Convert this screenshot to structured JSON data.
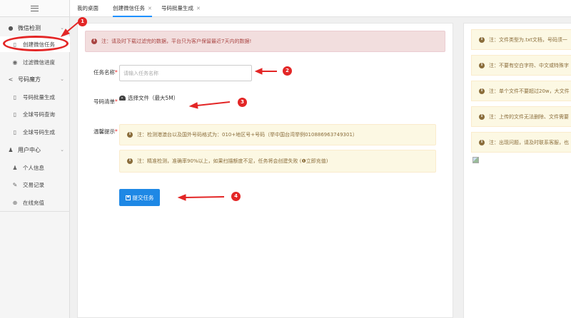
{
  "sidebar": {
    "groups": [
      {
        "label": "微信检测",
        "icon": "wechat-icon"
      },
      {
        "label": "号码魔方",
        "icon": "share-icon"
      },
      {
        "label": "用户中心",
        "icon": "users-icon"
      }
    ],
    "items": [
      {
        "label": "创建微信任务",
        "icon": "file-icon",
        "active": true
      },
      {
        "label": "过滤微信进度",
        "icon": "eye-icon"
      },
      {
        "label": "号码批量生成",
        "icon": "file-icon"
      },
      {
        "label": "全球号码查询",
        "icon": "file-icon"
      },
      {
        "label": "全球号码生成",
        "icon": "file-icon"
      },
      {
        "label": "个人信息",
        "icon": "user-icon"
      },
      {
        "label": "交易记录",
        "icon": "edit-icon"
      },
      {
        "label": "在线充值",
        "icon": "plus-circle-icon"
      }
    ]
  },
  "tabs": [
    {
      "label": "我的桌面",
      "closable": false
    },
    {
      "label": "创建微信任务",
      "closable": true,
      "active": true
    },
    {
      "label": "号码批量生成",
      "closable": true
    }
  ],
  "main": {
    "alert": "注：请及时下载过滤完的数据，平台只为客户保留最近7天内的数据!",
    "form": {
      "task_name_label": "任务名称",
      "task_name_placeholder": "请输入任务名称",
      "number_list_label": "号码清单",
      "upload_label": "选择文件（最大5M）",
      "tips_label": "温馨提示",
      "tips": [
        "注：检测港澳台以及国外号码格式为：010+地区号+号码（举中国台湾举例010886963749301）",
        "注：精准检测，准确率90%以上，如果扫描额度不足，任务将会创建失败  (❶立即充值)"
      ],
      "submit_label": "提交任务"
    }
  },
  "right_panel": {
    "notes": [
      "注：文件类型为.txt文档，号码须一",
      "注：不要有空白字符、中文或特殊字",
      "注：单个文件不要超过20w，大文件",
      "注：上传的文件无法删除、文件需要",
      "注：出现问题，请及时联系客服，也"
    ]
  },
  "annotations": [
    "1",
    "2",
    "3",
    "4"
  ],
  "colors": {
    "accent": "#1e88e5",
    "danger_bg": "#f2dede",
    "danger_text": "#a94442",
    "warning_bg": "#fcf8e3",
    "warning_text": "#8a6d3b",
    "annotation": "#e32626"
  }
}
